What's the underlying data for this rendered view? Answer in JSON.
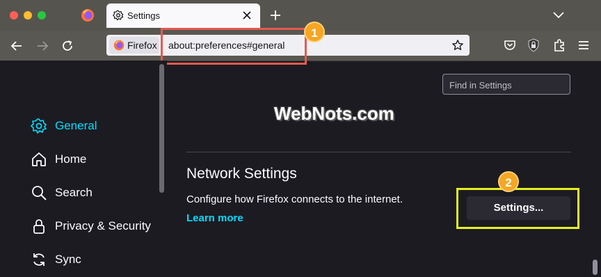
{
  "window": {
    "traffic_lights": {
      "close_color": "#ff5f57",
      "minimize_color": "#febc2e",
      "maximize_color": "#28c840"
    }
  },
  "tab": {
    "title": "Settings",
    "icon": "gear-icon",
    "close_icon": "close-icon"
  },
  "tabstrip": {
    "new_tab_icon": "plus-icon",
    "list_all_tabs_icon": "chevron-down-icon"
  },
  "toolbar": {
    "back_icon": "back-arrow-icon",
    "forward_icon": "forward-arrow-icon",
    "reload_icon": "reload-icon",
    "identity_label": "Firefox",
    "url": "about:preferences#general",
    "bookmark_icon": "star-icon",
    "pocket_icon": "pocket-icon",
    "extension_icon": "puzzle-icon",
    "menu_icon": "hamburger-menu-icon"
  },
  "annotations": {
    "step1": "1",
    "step2": "2",
    "highlight1_color": "#e85a50",
    "highlight2_color": "#e6f01e",
    "badge_color": "#f5a623"
  },
  "watermark": "WebNots.com",
  "sidebar": {
    "items": [
      {
        "label": "General",
        "icon": "gear-icon",
        "selected": true
      },
      {
        "label": "Home",
        "icon": "home-icon",
        "selected": false
      },
      {
        "label": "Search",
        "icon": "search-icon",
        "selected": false
      },
      {
        "label": "Privacy & Security",
        "icon": "lock-icon",
        "selected": false
      },
      {
        "label": "Sync",
        "icon": "sync-icon",
        "selected": false
      }
    ],
    "accent": "#00ddff"
  },
  "main": {
    "search_placeholder": "Find in Settings",
    "network": {
      "title": "Network Settings",
      "description": "Configure how Firefox connects to the internet.",
      "learn_more": "Learn more",
      "settings_button": "Settings..."
    }
  }
}
